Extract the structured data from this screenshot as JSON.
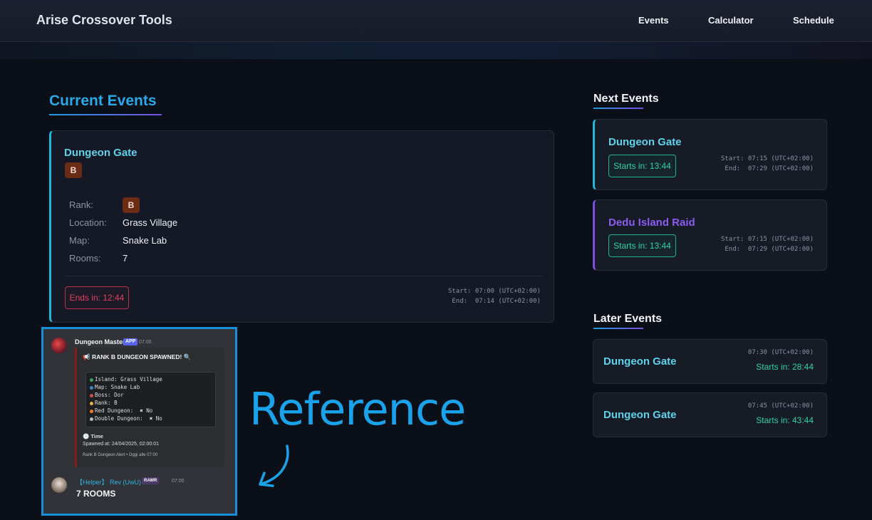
{
  "header": {
    "brand": "Arise Crossover Tools",
    "nav": [
      "Events",
      "Calculator",
      "Schedule"
    ]
  },
  "current": {
    "heading": "Current Events",
    "event": {
      "name": "Dungeon Gate",
      "rank_badge": "B",
      "details": [
        {
          "label": "Rank:",
          "value": "B",
          "is_badge": true
        },
        {
          "label": "Location:",
          "value": "Grass Village"
        },
        {
          "label": "Map:",
          "value": "Snake Lab"
        },
        {
          "label": "Rooms:",
          "value": "7"
        }
      ],
      "ends_in": "Ends in: 12:44",
      "start": "Start: 07:00 (UTC+02:00)",
      "end": "End:  07:14 (UTC+02:00)"
    }
  },
  "next": {
    "heading": "Next Events",
    "events": [
      {
        "name": "Dungeon Gate",
        "starts_in": "Starts in: 13:44",
        "start": "Start: 07:15 (UTC+02:00)",
        "end": "End:  07:29 (UTC+02:00)",
        "accent": "#23b6d8",
        "name_color": "#5fd2ea"
      },
      {
        "name": "Dedu Island Raid",
        "starts_in": "Starts in: 13:44",
        "start": "Start: 07:15 (UTC+02:00)",
        "end": "End:  07:29 (UTC+02:00)",
        "accent": "#7a4fe0",
        "name_color": "#8a5cf0"
      }
    ]
  },
  "later": {
    "heading": "Later Events",
    "events": [
      {
        "name": "Dungeon Gate",
        "time": "07:30 (UTC+02:00)",
        "starts_in": "Starts in: 28:44"
      },
      {
        "name": "Dungeon Gate",
        "time": "07:45 (UTC+02:00)",
        "starts_in": "Starts in: 43:44"
      }
    ]
  },
  "reference": {
    "label": "Reference",
    "message1": {
      "author": "Dungeon Master",
      "tag": "APP",
      "time": "07:00",
      "embed_title": "📢 RANK B DUNGEON SPAWNED! 🔍",
      "lines": [
        "Island: Grass Village",
        "Map: Snake Lab",
        "Boss: Dor",
        "Rank: B",
        "Red Dungeon:  ✖ No",
        "Double Dungeon:  ✖ No"
      ],
      "time_label": "🕓 Time",
      "spawned_at": "Spawned at: 24/04/2025, 02:00:01",
      "footer": "Rank B Dungeon Alert • Oggi alle 07:00"
    },
    "message2": {
      "author": "【Helper】 Rev (UwU)",
      "tag": "RAWR",
      "time": "07:00",
      "text": "7 ROOMS"
    }
  }
}
